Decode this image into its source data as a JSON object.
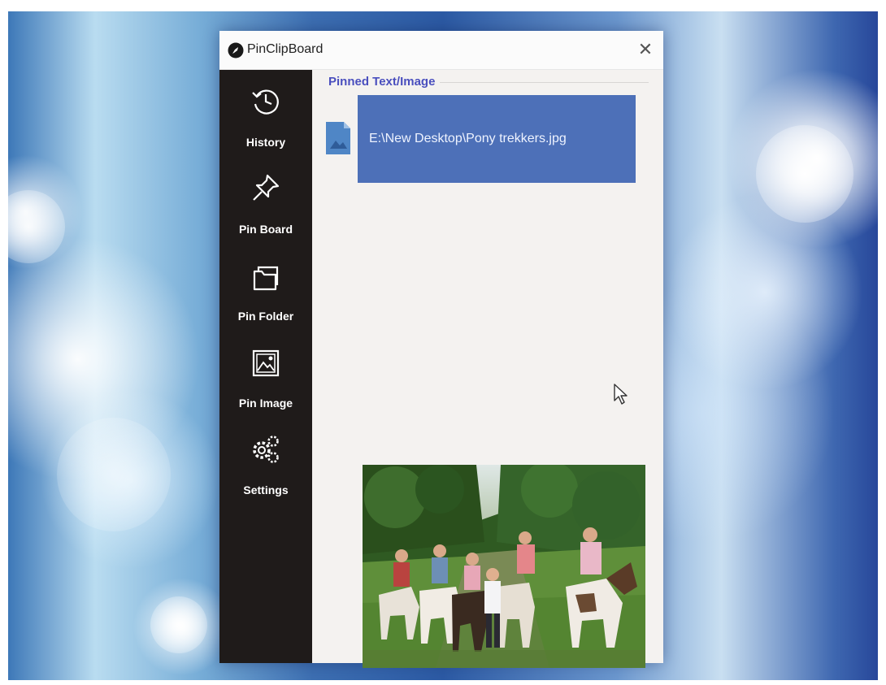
{
  "window": {
    "title": "PinClipBoard",
    "close_symbol": "✕"
  },
  "sidebar": {
    "items": [
      {
        "label": "History",
        "icon": "history-icon"
      },
      {
        "label": "Pin Board",
        "icon": "pin-icon"
      },
      {
        "label": "Pin Folder",
        "icon": "folder-icon"
      },
      {
        "label": "Pin Image",
        "icon": "image-icon"
      },
      {
        "label": "Settings",
        "icon": "gear-icon"
      }
    ]
  },
  "content": {
    "section_title": "Pinned Text/Image",
    "pinned_items": [
      {
        "text": "E:\\New Desktop\\Pony trekkers.jpg",
        "icon": "image-file-icon"
      }
    ]
  },
  "colors": {
    "sidebar_bg": "#1f1b1a",
    "accent": "#4d70b8",
    "section_label": "#4a4fbe",
    "content_bg": "#f4f2f0"
  }
}
